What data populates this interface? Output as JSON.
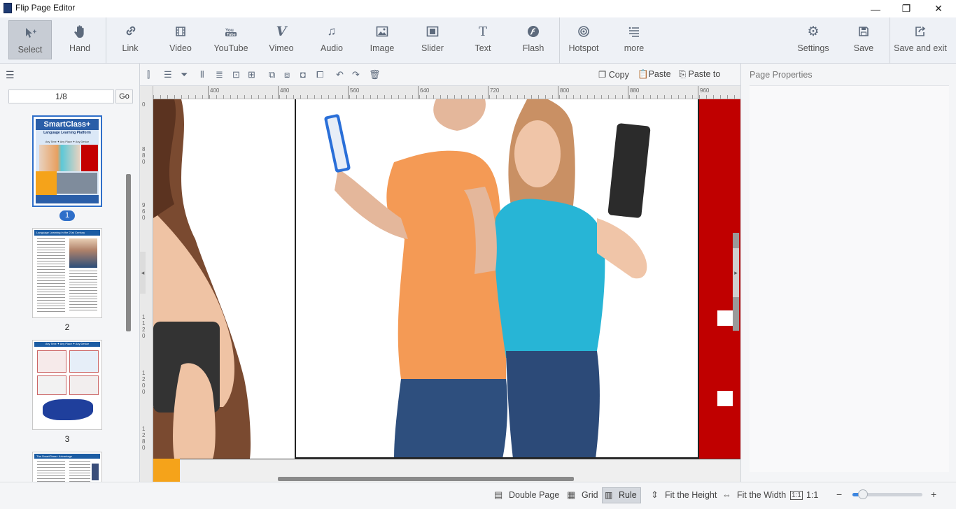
{
  "window": {
    "title": "Flip Page Editor",
    "minimize": "—",
    "restore": "❐",
    "close": "✕"
  },
  "toolbar": {
    "select": "Select",
    "hand": "Hand",
    "link": "Link",
    "video": "Video",
    "youtube": "YouTube",
    "vimeo": "Vimeo",
    "audio": "Audio",
    "image": "Image",
    "slider": "Slider",
    "text": "Text",
    "flash": "Flash",
    "hotspot": "Hotspot",
    "more": "more",
    "settings": "Settings",
    "save": "Save",
    "save_exit": "Save and exit"
  },
  "icons": {
    "select": "select-arrow-icon",
    "hand": "hand-icon",
    "link": "link-icon",
    "video": "film-icon",
    "youtube": "youtube-icon",
    "vimeo": "vimeo-icon",
    "audio": "music-note-icon",
    "image": "image-icon",
    "slider": "slider-icon",
    "text": "text-t-icon",
    "flash": "flash-icon",
    "hotspot": "target-icon",
    "more": "more-lines-icon",
    "settings": "gear-icon",
    "save": "floppy-icon",
    "save_exit": "export-icon"
  },
  "sidebar": {
    "page_indicator": "1/8",
    "go_label": "Go",
    "thumbnails": [
      {
        "number": "1",
        "title": "SmartClass+",
        "subtitle": "Language Learning Platform",
        "tagline": "Any Time ✦ Any Place ✦ Any Device"
      },
      {
        "number": "2",
        "title": "Language Learning in the 21st Century"
      },
      {
        "number": "3",
        "title": "Any Time ✦ Any Place ✦ Any Device"
      },
      {
        "number": "",
        "title": "The SmartClass+ Advantage"
      }
    ]
  },
  "edit": {
    "copy": "Copy",
    "paste": "Paste",
    "paste_to": "Paste to"
  },
  "ruler": {
    "h": [
      "400",
      "480",
      "560",
      "640",
      "720",
      "800",
      "880",
      "960"
    ],
    "v": [
      "0",
      "880",
      "960",
      "1120",
      "1200",
      "1280"
    ]
  },
  "right_panel": {
    "title": "Page Properties"
  },
  "status": {
    "double_page": "Double Page",
    "grid": "Grid",
    "rule": "Rule",
    "fit_height": "Fit the Height",
    "fit_width": "Fit the Width",
    "ratio": "1:1",
    "zoom_minus": "−",
    "zoom_plus": "+",
    "zoom_level": 0.15
  },
  "colors": {
    "accent": "#2f6fc9",
    "red_panel": "#c00000",
    "orange_tab": "#f5a31a"
  }
}
